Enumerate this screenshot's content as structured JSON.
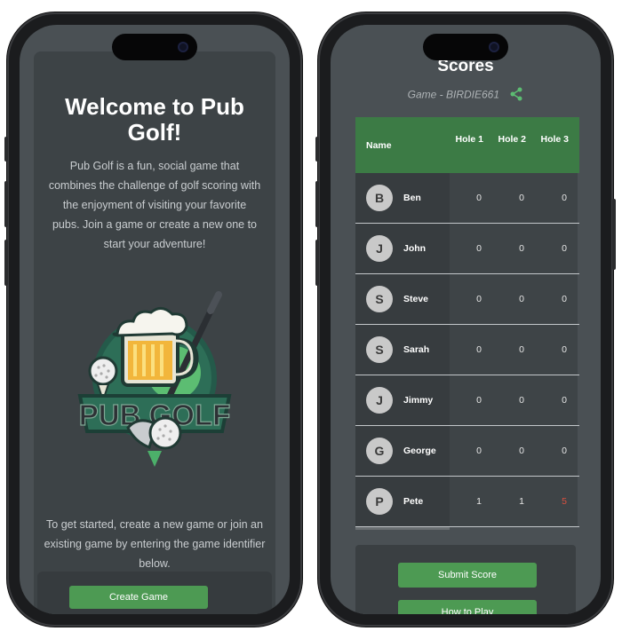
{
  "left_screen": {
    "title": "Welcome to Pub Golf!",
    "description": "Pub Golf is a fun, social game that combines the challenge of golf scoring with the enjoyment of visiting your favorite pubs. Join a game or create a new one to start your adventure!",
    "logo_text": "PUB GOLF",
    "get_started_text": "To get started, create a new game or join an existing game by entering the game identifier below.",
    "create_game_label": "Create Game"
  },
  "right_screen": {
    "title": "Scores",
    "game_label": "Game - BIRDIE661",
    "table": {
      "headers": {
        "name": "Name",
        "holes": [
          "Hole 1",
          "Hole 2",
          "Hole 3"
        ]
      },
      "rows": [
        {
          "initial": "B",
          "name": "Ben",
          "scores": [
            "0",
            "0",
            "0"
          ]
        },
        {
          "initial": "J",
          "name": "John",
          "scores": [
            "0",
            "0",
            "0"
          ]
        },
        {
          "initial": "S",
          "name": "Steve",
          "scores": [
            "0",
            "0",
            "0"
          ]
        },
        {
          "initial": "S",
          "name": "Sarah",
          "scores": [
            "0",
            "0",
            "0"
          ]
        },
        {
          "initial": "J",
          "name": "Jimmy",
          "scores": [
            "0",
            "0",
            "0"
          ]
        },
        {
          "initial": "G",
          "name": "George",
          "scores": [
            "0",
            "0",
            "0"
          ]
        },
        {
          "initial": "P",
          "name": "Pete",
          "scores": [
            "1",
            "1",
            "5"
          ]
        }
      ]
    },
    "submit_label": "Submit Score",
    "howto_label": "How to Play"
  },
  "icons": {
    "share": "share-icon",
    "logo": "pub-golf-logo"
  },
  "colors": {
    "accent_green": "#4d9a53",
    "header_green": "#3c7b45",
    "score_over": "#d9503f",
    "background": "#4a5054"
  }
}
